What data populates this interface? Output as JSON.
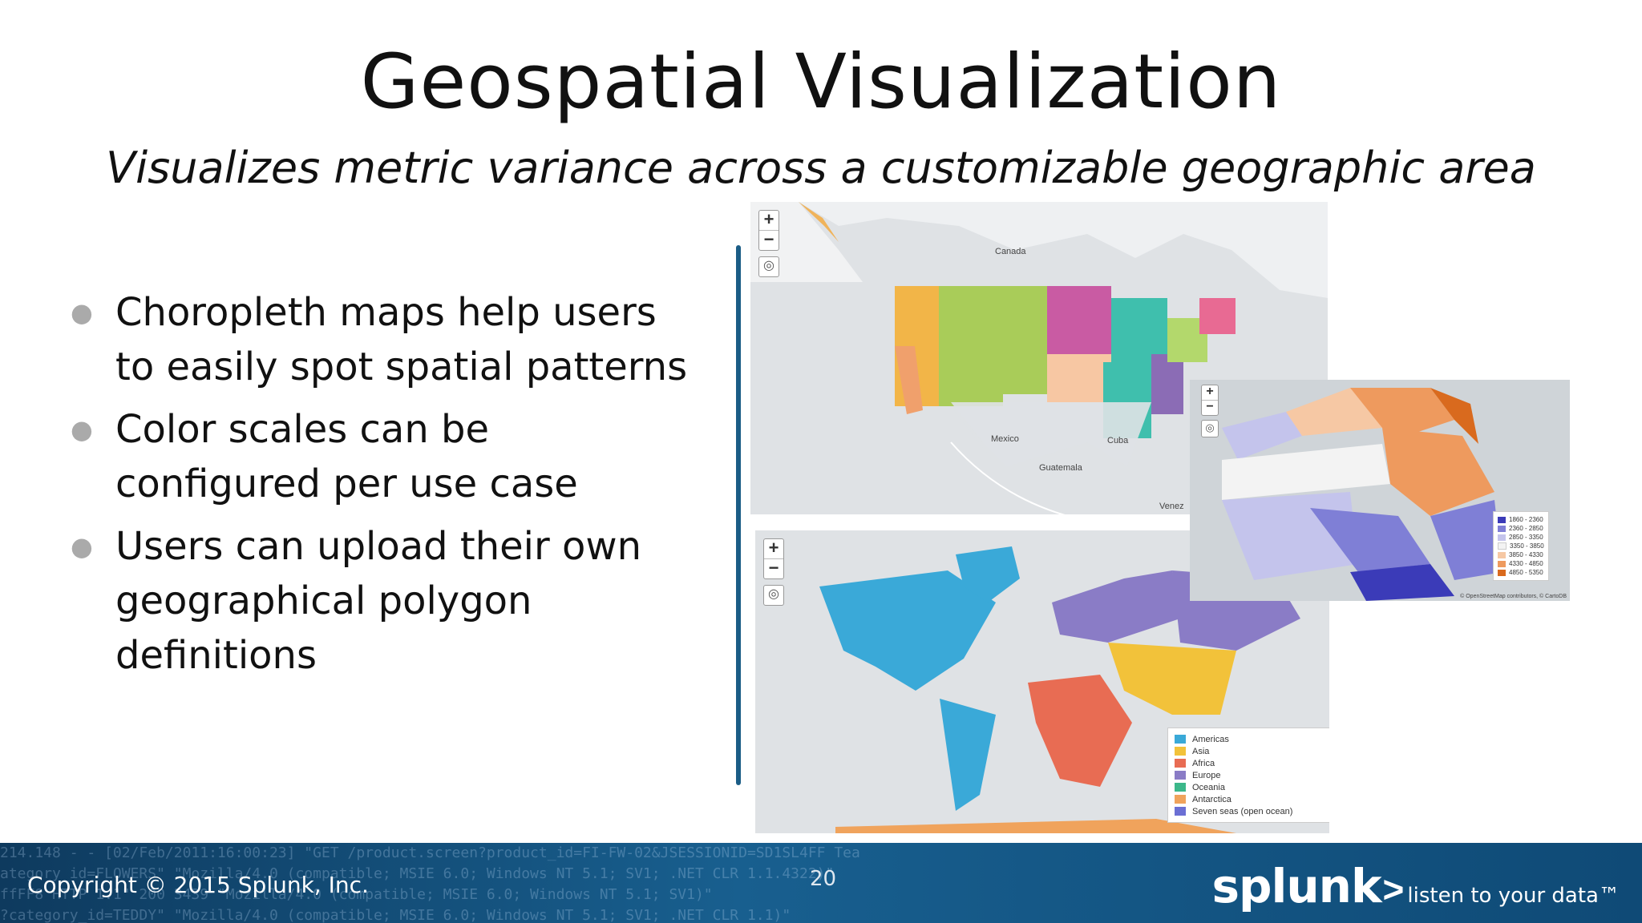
{
  "slide": {
    "title": "Geospatial Visualization",
    "subtitle": "Visualizes metric variance across a customizable geographic area",
    "bullets": [
      "Choropleth maps help users to easily spot spatial patterns",
      "Color scales can be configured per use case",
      "Users can upload their own geographical polygon definitions"
    ],
    "page_number": "20"
  },
  "maps": {
    "us_map": {
      "labels": [
        "Canada",
        "Mexico",
        "Cuba",
        "Guatemala",
        "Venez"
      ],
      "icons": [
        "zoom-in-icon",
        "zoom-out-icon",
        "locate-icon"
      ]
    },
    "world_map": {
      "legend": [
        {
          "label": "Americas",
          "color": "#3aa9d8"
        },
        {
          "label": "Asia",
          "color": "#f2c23a"
        },
        {
          "label": "Africa",
          "color": "#e86c53"
        },
        {
          "label": "Europe",
          "color": "#8a7cc6"
        },
        {
          "label": "Oceania",
          "color": "#3cb88a"
        },
        {
          "label": "Antarctica",
          "color": "#f0a35c"
        },
        {
          "label": "Seven seas (open ocean)",
          "color": "#6b6fd4"
        }
      ]
    },
    "sf_map": {
      "legend": [
        {
          "label": "1860 - 2360",
          "color": "#3b3bb8"
        },
        {
          "label": "2360 - 2850",
          "color": "#7f7fd6"
        },
        {
          "label": "2850 - 3350",
          "color": "#c4c4ec"
        },
        {
          "label": "3350 - 3850",
          "color": "#f3f3f3"
        },
        {
          "label": "3850 - 4330",
          "color": "#f6c8a4"
        },
        {
          "label": "4330 - 4850",
          "color": "#ee9a5e"
        },
        {
          "label": "4850 - 5350",
          "color": "#d96a1e"
        }
      ],
      "attribution": "© OpenStreetMap contributors, © CartoDB"
    }
  },
  "footer": {
    "copyright": "Copyright © 2015 Splunk, Inc.",
    "logo": "splunk",
    "logo_mark": ">",
    "tagline": "listen to your data™",
    "code_lines": [
      "214.148 - - [02/Feb/2011:16:00:23] \"GET /product.screen?product_id=FI-FW-02&JSESSIONID=SD1SL4FF Tea",
      "ategory_id=FLOWERS\" \"Mozilla/4.0 (compatible; MSIE 6.0; Windows NT 5.1; SV1; .NET CLR 1.1.4322)\"",
      "ffFF8 HTTP 1.1\" 200 3439 \"Mozilla/4.0 (compatible; MSIE 6.0; Windows NT 5.1; SV1)\"",
      "?category_id=TEDDY\" \"Mozilla/4.0 (compatible; MSIE 6.0; Windows NT 5.1; SV1; .NET CLR 1.1)\""
    ]
  }
}
